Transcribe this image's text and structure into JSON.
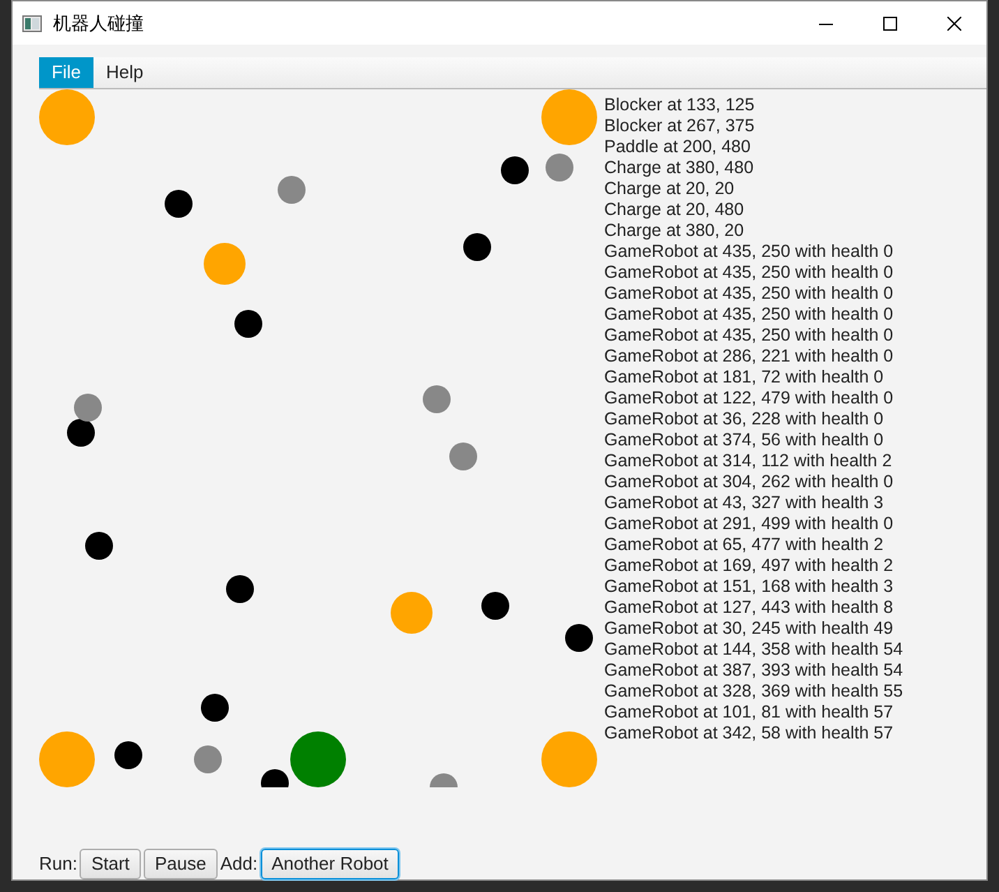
{
  "window": {
    "title": "机器人碰撞"
  },
  "menu": [
    {
      "label": "File",
      "selected": true
    },
    {
      "label": "Help",
      "selected": false
    }
  ],
  "log": [
    "Blocker at 133, 125",
    "Blocker at 267, 375",
    "Paddle at 200, 480",
    "Charge at 380, 480",
    "Charge at 20, 20",
    "Charge at 20, 480",
    "Charge at 380, 20",
    "GameRobot at 435, 250 with health 0",
    "GameRobot at 435, 250 with health 0",
    "GameRobot at 435, 250 with health 0",
    "GameRobot at 435, 250 with health 0",
    "GameRobot at 435, 250 with health 0",
    "GameRobot at 286, 221 with health 0",
    "GameRobot at 181, 72 with health 0",
    "GameRobot at 122, 479 with health 0",
    "GameRobot at 36, 228 with health 0",
    "GameRobot at 374, 56 with health 0",
    "GameRobot at 314, 112 with health 2",
    "GameRobot at 304, 262 with health 0",
    "GameRobot at 43, 327 with health 3",
    "GameRobot at 291, 499 with health 0",
    "GameRobot at 65, 477 with health 2",
    "GameRobot at 169, 497 with health 2",
    "GameRobot at 151, 168 with health 3",
    "GameRobot at 127, 443 with health 8",
    "GameRobot at 30, 245 with health 49",
    "GameRobot at 144, 358 with health 54",
    "GameRobot at 387, 393 with health 54",
    "GameRobot at 328, 369 with health 55",
    "GameRobot at 101, 81 with health 57",
    "GameRobot at 342, 58 with health 57"
  ],
  "toolbar": [
    {
      "kind": "label",
      "text": "Run:"
    },
    {
      "kind": "button",
      "text": "Start",
      "focused": false
    },
    {
      "kind": "button",
      "text": "Pause",
      "focused": false
    },
    {
      "kind": "label",
      "text": "Add:"
    },
    {
      "kind": "button",
      "text": "Another Robot",
      "focused": true
    }
  ]
}
